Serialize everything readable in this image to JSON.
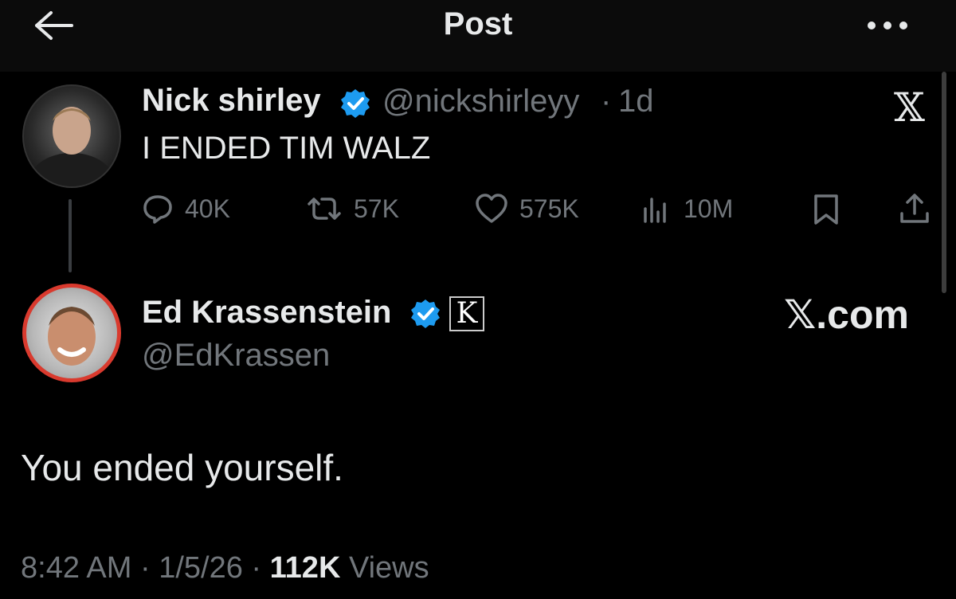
{
  "header": {
    "title": "Post"
  },
  "post1": {
    "name": "Nick shirley",
    "handle": "@nickshirleyy",
    "separator": "·",
    "time": "1d",
    "logo": "𝕏",
    "text": "I ENDED TIM WALZ",
    "stats": {
      "replies": "40K",
      "reposts": "57K",
      "likes": "575K",
      "views": "10M"
    }
  },
  "post2": {
    "name": "Ed Krassenstein",
    "badge": "K",
    "handle": "@EdKrassen",
    "brand": "𝕏.com",
    "text": "You ended yourself."
  },
  "meta": {
    "time": "8:42 AM",
    "sep1": " · ",
    "date": "1/5/26",
    "sep2": " · ",
    "views_count": "112K",
    "views_label": " Views"
  },
  "icons": {
    "back": "arrow-left-icon",
    "more": "more-horizontal-icon",
    "verified": "verified-badge-icon",
    "reply": "reply-icon",
    "repost": "repost-icon",
    "like": "heart-icon",
    "views": "analytics-icon",
    "bookmark": "bookmark-icon",
    "share": "share-icon"
  },
  "colors": {
    "background": "#000000",
    "text": "#e7e9ea",
    "muted": "#71767b",
    "verified": "#1d9bf0",
    "avatar_ring": "#d93a2e"
  }
}
